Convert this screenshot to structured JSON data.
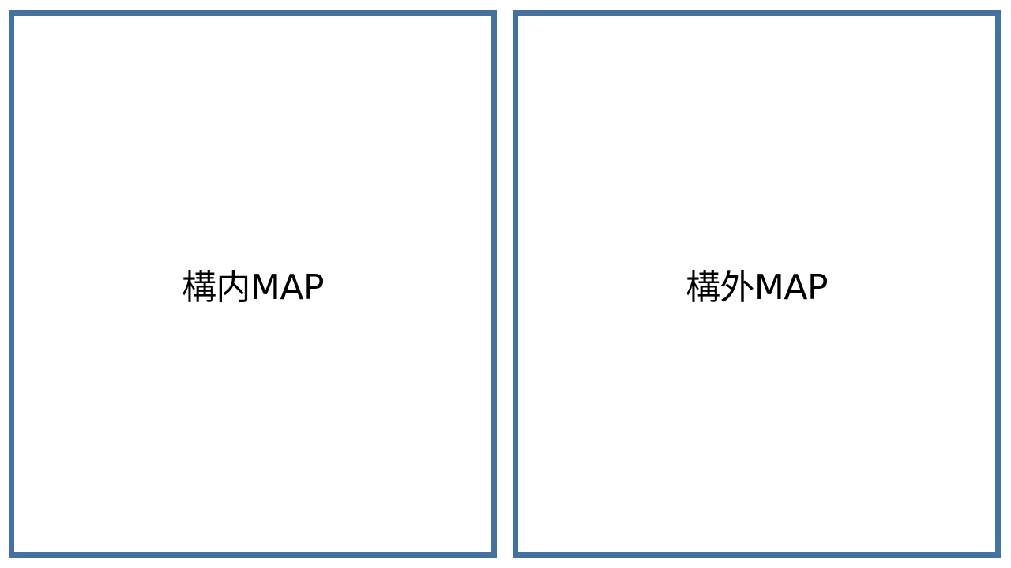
{
  "panels": {
    "inner_map": {
      "label": "構内MAP"
    },
    "outer_map": {
      "label": "構外MAP"
    }
  },
  "colors": {
    "border": "#4472A0",
    "background": "#FFFFFF",
    "text": "#000000"
  }
}
